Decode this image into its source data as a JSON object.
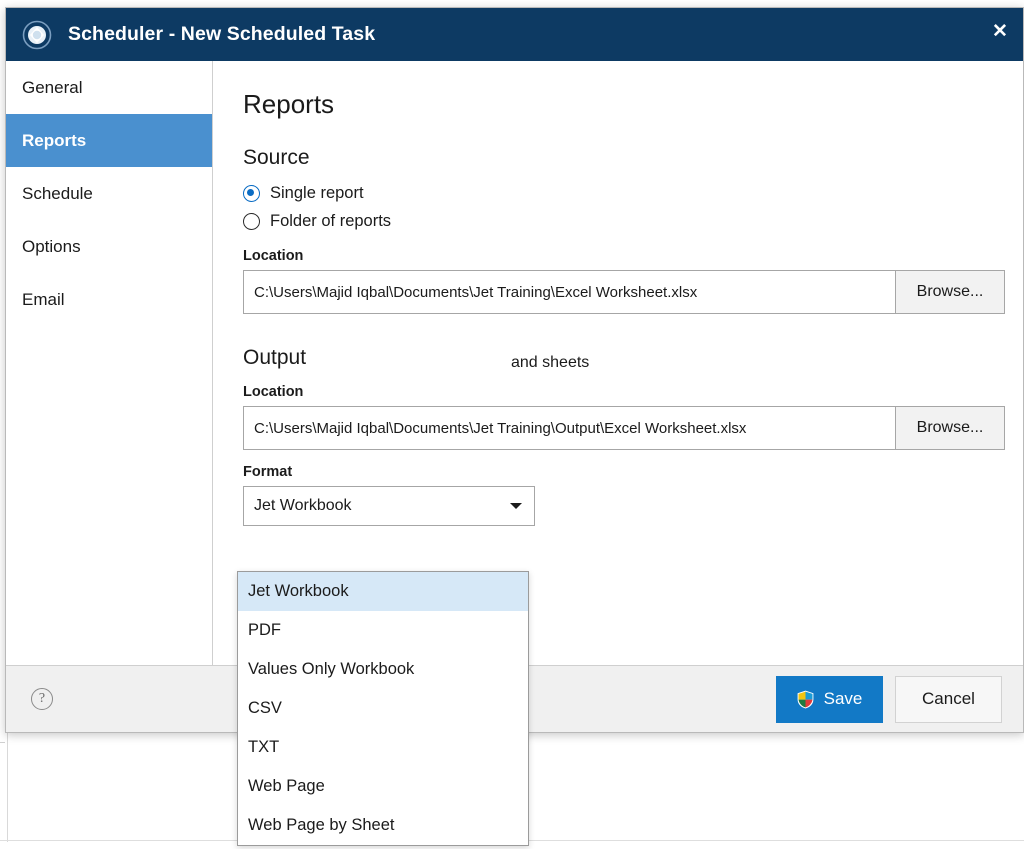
{
  "window": {
    "title": "Scheduler - New Scheduled Task",
    "logo_icon": "scheduler-orb-icon",
    "close_icon": "✕"
  },
  "sidebar": {
    "items": [
      {
        "label": "General",
        "selected": false
      },
      {
        "label": "Reports",
        "selected": true
      },
      {
        "label": "Schedule",
        "selected": false
      },
      {
        "label": "Options",
        "selected": false
      },
      {
        "label": "Email",
        "selected": false
      }
    ]
  },
  "content": {
    "page_title": "Reports",
    "source": {
      "heading": "Source",
      "radios": [
        {
          "label": "Single report",
          "checked": true
        },
        {
          "label": "Folder of reports",
          "checked": false
        }
      ],
      "location_label": "Location",
      "location_value": "C:\\Users\\Majid Iqbal\\Documents\\Jet Training\\Excel Worksheet.xlsx",
      "browse_label": "Browse..."
    },
    "output": {
      "heading": "Output",
      "location_label": "Location",
      "location_value": "C:\\Users\\Majid Iqbal\\Documents\\Jet Training\\Output\\Excel Worksheet.xlsx",
      "browse_label": "Browse...",
      "format_label": "Format",
      "format_value": "Jet Workbook",
      "obscured_text": "and sheets"
    }
  },
  "dropdown": {
    "open": true,
    "options": [
      {
        "label": "Jet Workbook",
        "highlighted": true
      },
      {
        "label": "PDF",
        "highlighted": false
      },
      {
        "label": "Values Only Workbook",
        "highlighted": false
      },
      {
        "label": "CSV",
        "highlighted": false
      },
      {
        "label": "TXT",
        "highlighted": false
      },
      {
        "label": "Web Page",
        "highlighted": false
      },
      {
        "label": "Web Page by Sheet",
        "highlighted": false
      }
    ]
  },
  "footer": {
    "help_icon": "?",
    "save_label": "Save",
    "save_icon": "uac-shield-icon",
    "cancel_label": "Cancel"
  },
  "colors": {
    "titlebar": "#0d3a63",
    "accent": "#4a90cf",
    "primary_button": "#1279c6",
    "radio_accent": "#0a6cc4",
    "dropdown_highlight": "#d6e8f7"
  }
}
